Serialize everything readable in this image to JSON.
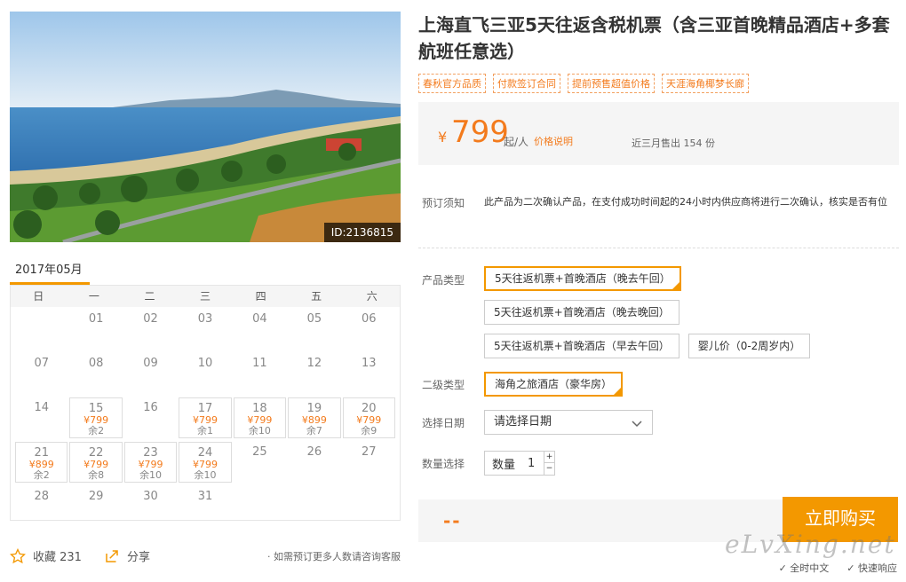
{
  "photo": {
    "id_label": "ID:2136815"
  },
  "calendar": {
    "month": "2017年05月",
    "weekdays": [
      "日",
      "一",
      "二",
      "三",
      "四",
      "五",
      "六"
    ],
    "days": [
      {
        "d": ""
      },
      {
        "d": "01"
      },
      {
        "d": "02"
      },
      {
        "d": "03"
      },
      {
        "d": "04"
      },
      {
        "d": "05"
      },
      {
        "d": "06"
      },
      {
        "d": "07"
      },
      {
        "d": "08"
      },
      {
        "d": "09"
      },
      {
        "d": "10"
      },
      {
        "d": "11"
      },
      {
        "d": "12"
      },
      {
        "d": "13"
      },
      {
        "d": "14"
      },
      {
        "d": "15",
        "p": "¥799",
        "r": "余2"
      },
      {
        "d": "16"
      },
      {
        "d": "17",
        "p": "¥799",
        "r": "余1"
      },
      {
        "d": "18",
        "p": "¥799",
        "r": "余10"
      },
      {
        "d": "19",
        "p": "¥899",
        "r": "余7"
      },
      {
        "d": "20",
        "p": "¥799",
        "r": "余9"
      },
      {
        "d": "21",
        "p": "¥899",
        "r": "余2"
      },
      {
        "d": "22",
        "p": "¥799",
        "r": "余8"
      },
      {
        "d": "23",
        "p": "¥799",
        "r": "余10"
      },
      {
        "d": "24",
        "p": "¥799",
        "r": "余10"
      },
      {
        "d": "25"
      },
      {
        "d": "26"
      },
      {
        "d": "27"
      },
      {
        "d": "28"
      },
      {
        "d": "29"
      },
      {
        "d": "30"
      },
      {
        "d": "31"
      },
      {
        "d": ""
      },
      {
        "d": ""
      },
      {
        "d": ""
      }
    ]
  },
  "share": {
    "favorite_label": "收藏 231",
    "share_label": "分享",
    "note": "· 如需预订更多人数请咨询客服"
  },
  "product": {
    "title": "上海直飞三亚5天往返含税机票（含三亚首晚精品酒店+多套航班任意选）",
    "tags": [
      "春秋官方品质",
      "付款签订合同",
      "提前预售超值价格",
      "天涯海角椰梦长廊"
    ],
    "currency": "¥",
    "price": "799",
    "price_unit": "起/人",
    "price_explain": "价格说明",
    "sold": "近三月售出 154 份",
    "notice_label": "预订须知",
    "notice_text": "此产品为二次确认产品，在支付成功时间起的24小时内供应商将进行二次确认，核实是否有位",
    "type_label": "产品类型",
    "types": [
      "5天往返机票+首晚酒店（晚去午回）",
      "5天往返机票+首晚酒店（晚去晚回）",
      "5天往返机票+首晚酒店（早去午回）",
      "婴儿价（0-2周岁内）"
    ],
    "subtype_label": "二级类型",
    "subtype": "海角之旅酒店（豪华房）",
    "date_label": "选择日期",
    "date_placeholder": "请选择日期",
    "qty_label": "数量选择",
    "qty_prefix": "数量",
    "qty_value": "1",
    "total": "--",
    "buy_label": "立即购买"
  },
  "footer": {
    "watermark": "eLvXing.net",
    "badge1": "全时中文",
    "badge2": "快速响应"
  },
  "colors": {
    "accent": "#f39800",
    "price": "#f37b1d"
  }
}
